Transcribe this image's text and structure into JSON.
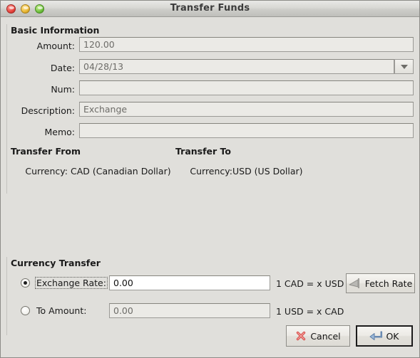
{
  "window": {
    "title": "Transfer Funds",
    "controls": [
      {
        "name": "close",
        "color": "#e8433c"
      },
      {
        "name": "minimize",
        "color": "#e9b733"
      },
      {
        "name": "zoom",
        "color": "#70c13e"
      }
    ]
  },
  "basic_information": {
    "heading": "Basic Information",
    "fields": [
      {
        "label": "Amount:",
        "value": "120.00",
        "enabled": false,
        "key": "amount"
      },
      {
        "label": "Date:",
        "value": "04/28/13",
        "enabled": false,
        "key": "date"
      },
      {
        "label": "Num:",
        "value": "",
        "enabled": false,
        "key": "num"
      },
      {
        "label": "Description:",
        "value": "Exchange",
        "enabled": false,
        "key": "description"
      },
      {
        "label": "Memo:",
        "value": "",
        "enabled": false,
        "key": "memo"
      }
    ],
    "date_dropdown_icon": "chevron-down-icon"
  },
  "transfer_from": {
    "heading": "Transfer From",
    "currency_label": "Currency:",
    "currency_value": "CAD (Canadian Dollar)"
  },
  "transfer_to": {
    "heading": "Transfer To",
    "currency_label": "Currency:",
    "currency_value": "USD (US Dollar)"
  },
  "currency_transfer": {
    "heading": "Currency Transfer",
    "exchange_rate": {
      "radio_label": "Exchange Rate:",
      "selected": true,
      "value": "0.00",
      "enabled": true,
      "formula": "1 CAD = x USD"
    },
    "to_amount": {
      "radio_label": "To Amount:",
      "selected": false,
      "value": "0.00",
      "enabled": false,
      "formula": "1 USD = x CAD"
    },
    "fetch_rate_button": {
      "label": "Fetch Rate",
      "icon": "antenna-icon"
    }
  },
  "actions": {
    "cancel": {
      "label": "Cancel",
      "icon": "red-x-icon"
    },
    "ok": {
      "label": "OK",
      "icon": "enter-arrow-icon",
      "default": true
    }
  }
}
